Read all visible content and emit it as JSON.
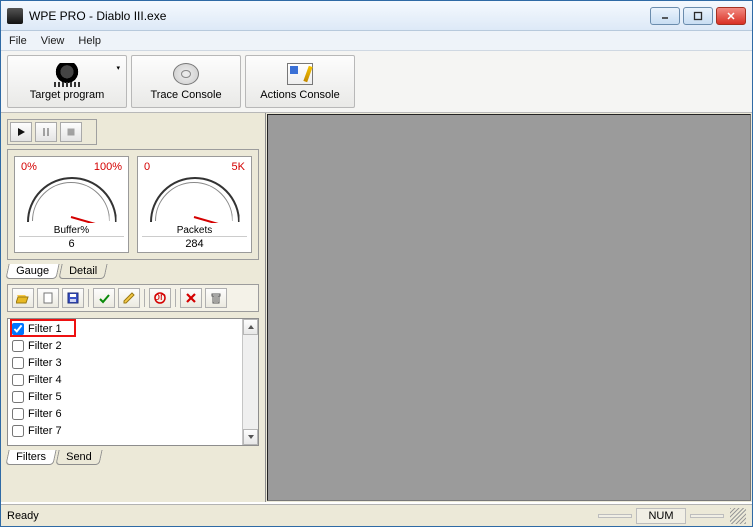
{
  "title": "WPE PRO - Diablo III.exe",
  "menu": {
    "file": "File",
    "view": "View",
    "help": "Help"
  },
  "toolbar": {
    "target": "Target program",
    "trace": "Trace Console",
    "actions": "Actions Console"
  },
  "gauges": {
    "buffer": {
      "min": "0%",
      "max": "100%",
      "label": "Buffer%",
      "value": "6"
    },
    "packets": {
      "min": "0",
      "max": "5K",
      "label": "Packets",
      "value": "284"
    }
  },
  "gauge_tabs": {
    "gauge": "Gauge",
    "detail": "Detail"
  },
  "filters": {
    "items": [
      {
        "label": "Filter 1",
        "checked": true
      },
      {
        "label": "Filter 2",
        "checked": false
      },
      {
        "label": "Filter 3",
        "checked": false
      },
      {
        "label": "Filter 4",
        "checked": false
      },
      {
        "label": "Filter 5",
        "checked": false
      },
      {
        "label": "Filter 6",
        "checked": false
      },
      {
        "label": "Filter 7",
        "checked": false
      }
    ],
    "icons": [
      "open",
      "new",
      "save",
      "apply",
      "edit",
      "toggle",
      "delete-red",
      "trash"
    ]
  },
  "filter_tabs": {
    "filters": "Filters",
    "send": "Send"
  },
  "status": {
    "ready": "Ready",
    "num": "NUM"
  }
}
